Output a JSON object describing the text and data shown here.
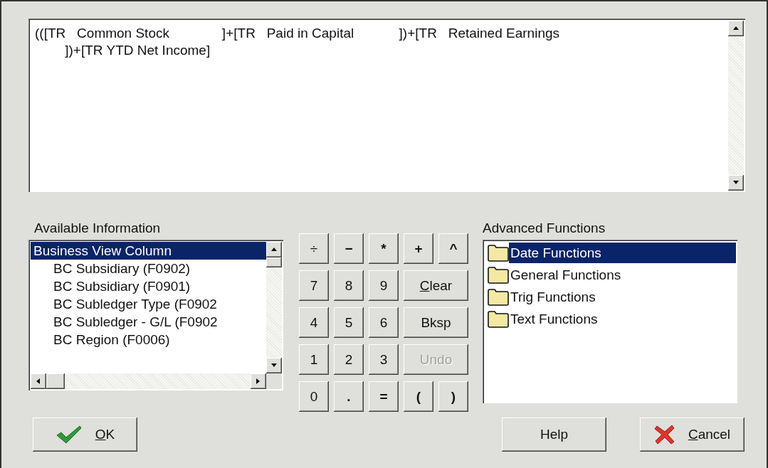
{
  "expression": {
    "lines": [
      "(([TR   Common Stock              ]+[TR   Paid in Capital            ])+[TR   Retained Earnings",
      "        ])+[TR YTD Net Income]"
    ]
  },
  "available_information": {
    "label": "Available Information",
    "items": [
      {
        "label": "Business View Column",
        "selected": true,
        "children": [
          {
            "label": "BC Subsidiary (F0902)",
            "selected": false
          },
          {
            "label": "BC Subsidiary (F0901)",
            "selected": false
          },
          {
            "label": "BC Subledger Type (F0902",
            "selected": false
          },
          {
            "label": "BC Subledger - G/L (F0902",
            "selected": false
          },
          {
            "label": "BC Region (F0006)",
            "selected": false
          }
        ]
      }
    ]
  },
  "keypad": {
    "rows": [
      [
        {
          "label": "÷",
          "kind": "key",
          "disabled": false
        },
        {
          "label": "−",
          "kind": "key",
          "disabled": false
        },
        {
          "label": "*",
          "kind": "key",
          "disabled": false
        },
        {
          "label": "+",
          "kind": "key",
          "disabled": false
        },
        {
          "label": "^",
          "kind": "key",
          "disabled": false
        }
      ],
      [
        {
          "label": "7",
          "kind": "key",
          "disabled": false
        },
        {
          "label": "8",
          "kind": "key",
          "disabled": false
        },
        {
          "label": "9",
          "kind": "key",
          "disabled": false
        },
        {
          "label": "Clear",
          "kind": "wide",
          "disabled": false,
          "underline_first": true
        }
      ],
      [
        {
          "label": "4",
          "kind": "key",
          "disabled": false
        },
        {
          "label": "5",
          "kind": "key",
          "disabled": false
        },
        {
          "label": "6",
          "kind": "key",
          "disabled": false
        },
        {
          "label": "Bksp",
          "kind": "wide",
          "disabled": false
        }
      ],
      [
        {
          "label": "1",
          "kind": "key",
          "disabled": false
        },
        {
          "label": "2",
          "kind": "key",
          "disabled": false
        },
        {
          "label": "3",
          "kind": "key",
          "disabled": false
        },
        {
          "label": "Undo",
          "kind": "wide",
          "disabled": true
        }
      ],
      [
        {
          "label": "0",
          "kind": "key",
          "disabled": false
        },
        {
          "label": ".",
          "kind": "key",
          "disabled": false
        },
        {
          "label": "=",
          "kind": "key",
          "disabled": false
        },
        {
          "label": "(",
          "kind": "key",
          "disabled": false
        },
        {
          "label": ")",
          "kind": "key",
          "disabled": false
        }
      ]
    ]
  },
  "advanced_functions": {
    "label": "Advanced Functions",
    "items": [
      {
        "label": "Date Functions",
        "selected": true
      },
      {
        "label": "General Functions",
        "selected": false
      },
      {
        "label": "Trig Functions",
        "selected": false
      },
      {
        "label": "Text Functions",
        "selected": false
      }
    ]
  },
  "buttons": [
    {
      "label": "OK",
      "kind": "ok",
      "underline_first": true
    },
    {
      "label": "Help",
      "kind": "help"
    },
    {
      "label": "Cancel",
      "kind": "cancel",
      "underline_first": true
    }
  ]
}
